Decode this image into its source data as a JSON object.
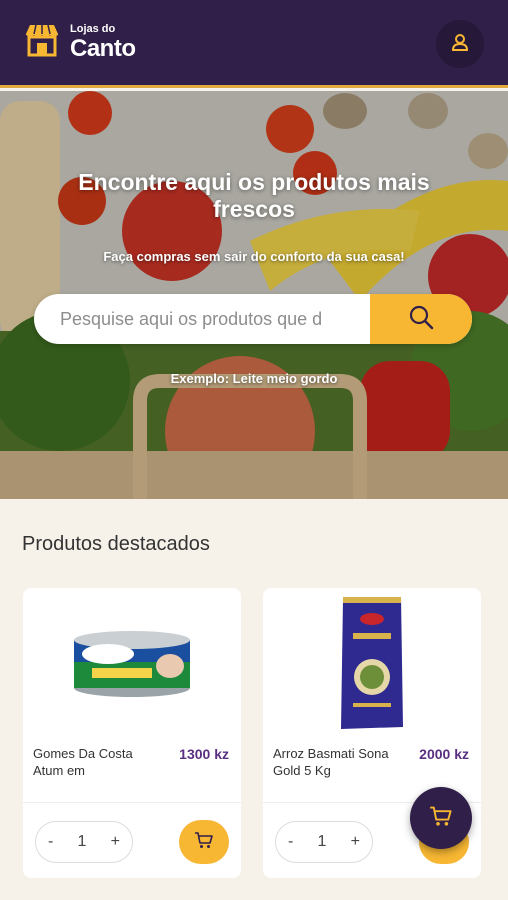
{
  "header": {
    "logo_small": "Lojas do",
    "logo_big": "Canto",
    "account_icon": "user-icon"
  },
  "hero": {
    "title": "Encontre aqui os produtos mais frescos",
    "subtitle": "Faça compras sem sair do conforto da sua casa!",
    "search_placeholder": "Pesquise aqui os produtos que d",
    "search_icon": "search-icon",
    "example": "Exemplo: Leite meio gordo"
  },
  "featured": {
    "title": "Produtos destacados",
    "products": [
      {
        "name": "Gomes Da Costa Atum em",
        "price": "1300 kz",
        "quantity": "1",
        "decrement": "-",
        "increment": "+"
      },
      {
        "name": "Arroz Basmati Sona Gold 5 Kg",
        "price": "2000 kz",
        "quantity": "1",
        "decrement": "-",
        "increment": "+"
      }
    ]
  },
  "cart_fab_icon": "cart-icon",
  "colors": {
    "primary": "#2f1f49",
    "accent": "#f7b733",
    "price": "#5a2f82"
  }
}
